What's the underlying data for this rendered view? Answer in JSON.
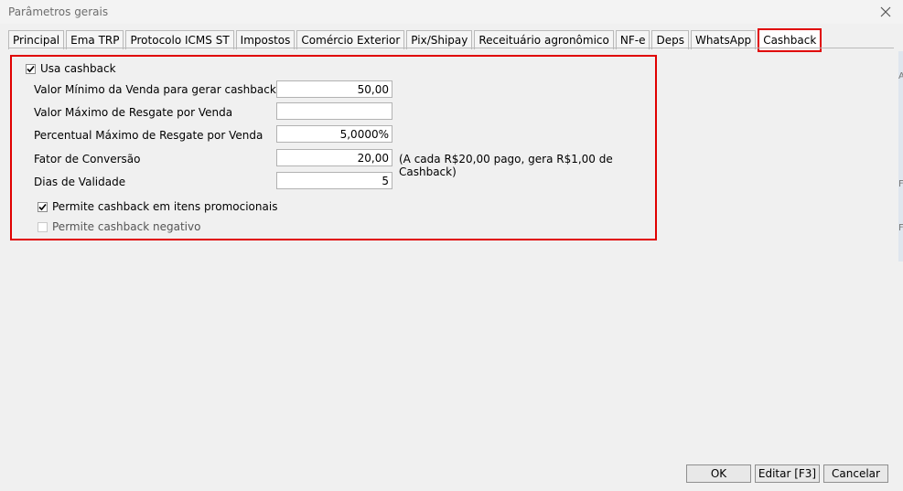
{
  "window": {
    "title": "Parâmetros gerais"
  },
  "tabs": [
    {
      "label": "Principal",
      "active": false
    },
    {
      "label": "Ema TRP",
      "active": false
    },
    {
      "label": "Protocolo ICMS ST",
      "active": false
    },
    {
      "label": "Impostos",
      "active": false
    },
    {
      "label": "Comércio Exterior",
      "active": false
    },
    {
      "label": "Pix/Shipay",
      "active": false
    },
    {
      "label": "Receituário agronômico",
      "active": false
    },
    {
      "label": "NF-e",
      "active": false
    },
    {
      "label": "Deps",
      "active": false
    },
    {
      "label": "WhatsApp",
      "active": false
    },
    {
      "label": "Cashback",
      "active": true
    }
  ],
  "cashback": {
    "usa_cashback": {
      "label": "Usa cashback",
      "checked": true
    },
    "fields": [
      {
        "label": "Valor Mínimo da Venda para gerar cashback",
        "value": "50,00"
      },
      {
        "label": "Valor Máximo de Resgate por Venda",
        "value": ""
      },
      {
        "label": "Percentual Máximo de Resgate por Venda",
        "value": "5,0000%"
      },
      {
        "label": "Fator de Conversão",
        "value": "20,00",
        "hint": "(A cada R$20,00 pago, gera R$1,00 de Cashback)"
      },
      {
        "label": "Dias de Validade",
        "value": "5"
      }
    ],
    "permite_promocionais": {
      "label": "Permite cashback em itens promocionais",
      "checked": true
    },
    "permite_negativo": {
      "label": "Permite cashback negativo",
      "checked": false
    }
  },
  "buttons": {
    "ok": "OK",
    "editar": "Editar [F3]",
    "cancelar": "Cancelar"
  },
  "edge_marks": [
    "A",
    "F",
    "F"
  ],
  "colors": {
    "highlight": "#e00000",
    "window_bg": "#f0f0f0"
  }
}
